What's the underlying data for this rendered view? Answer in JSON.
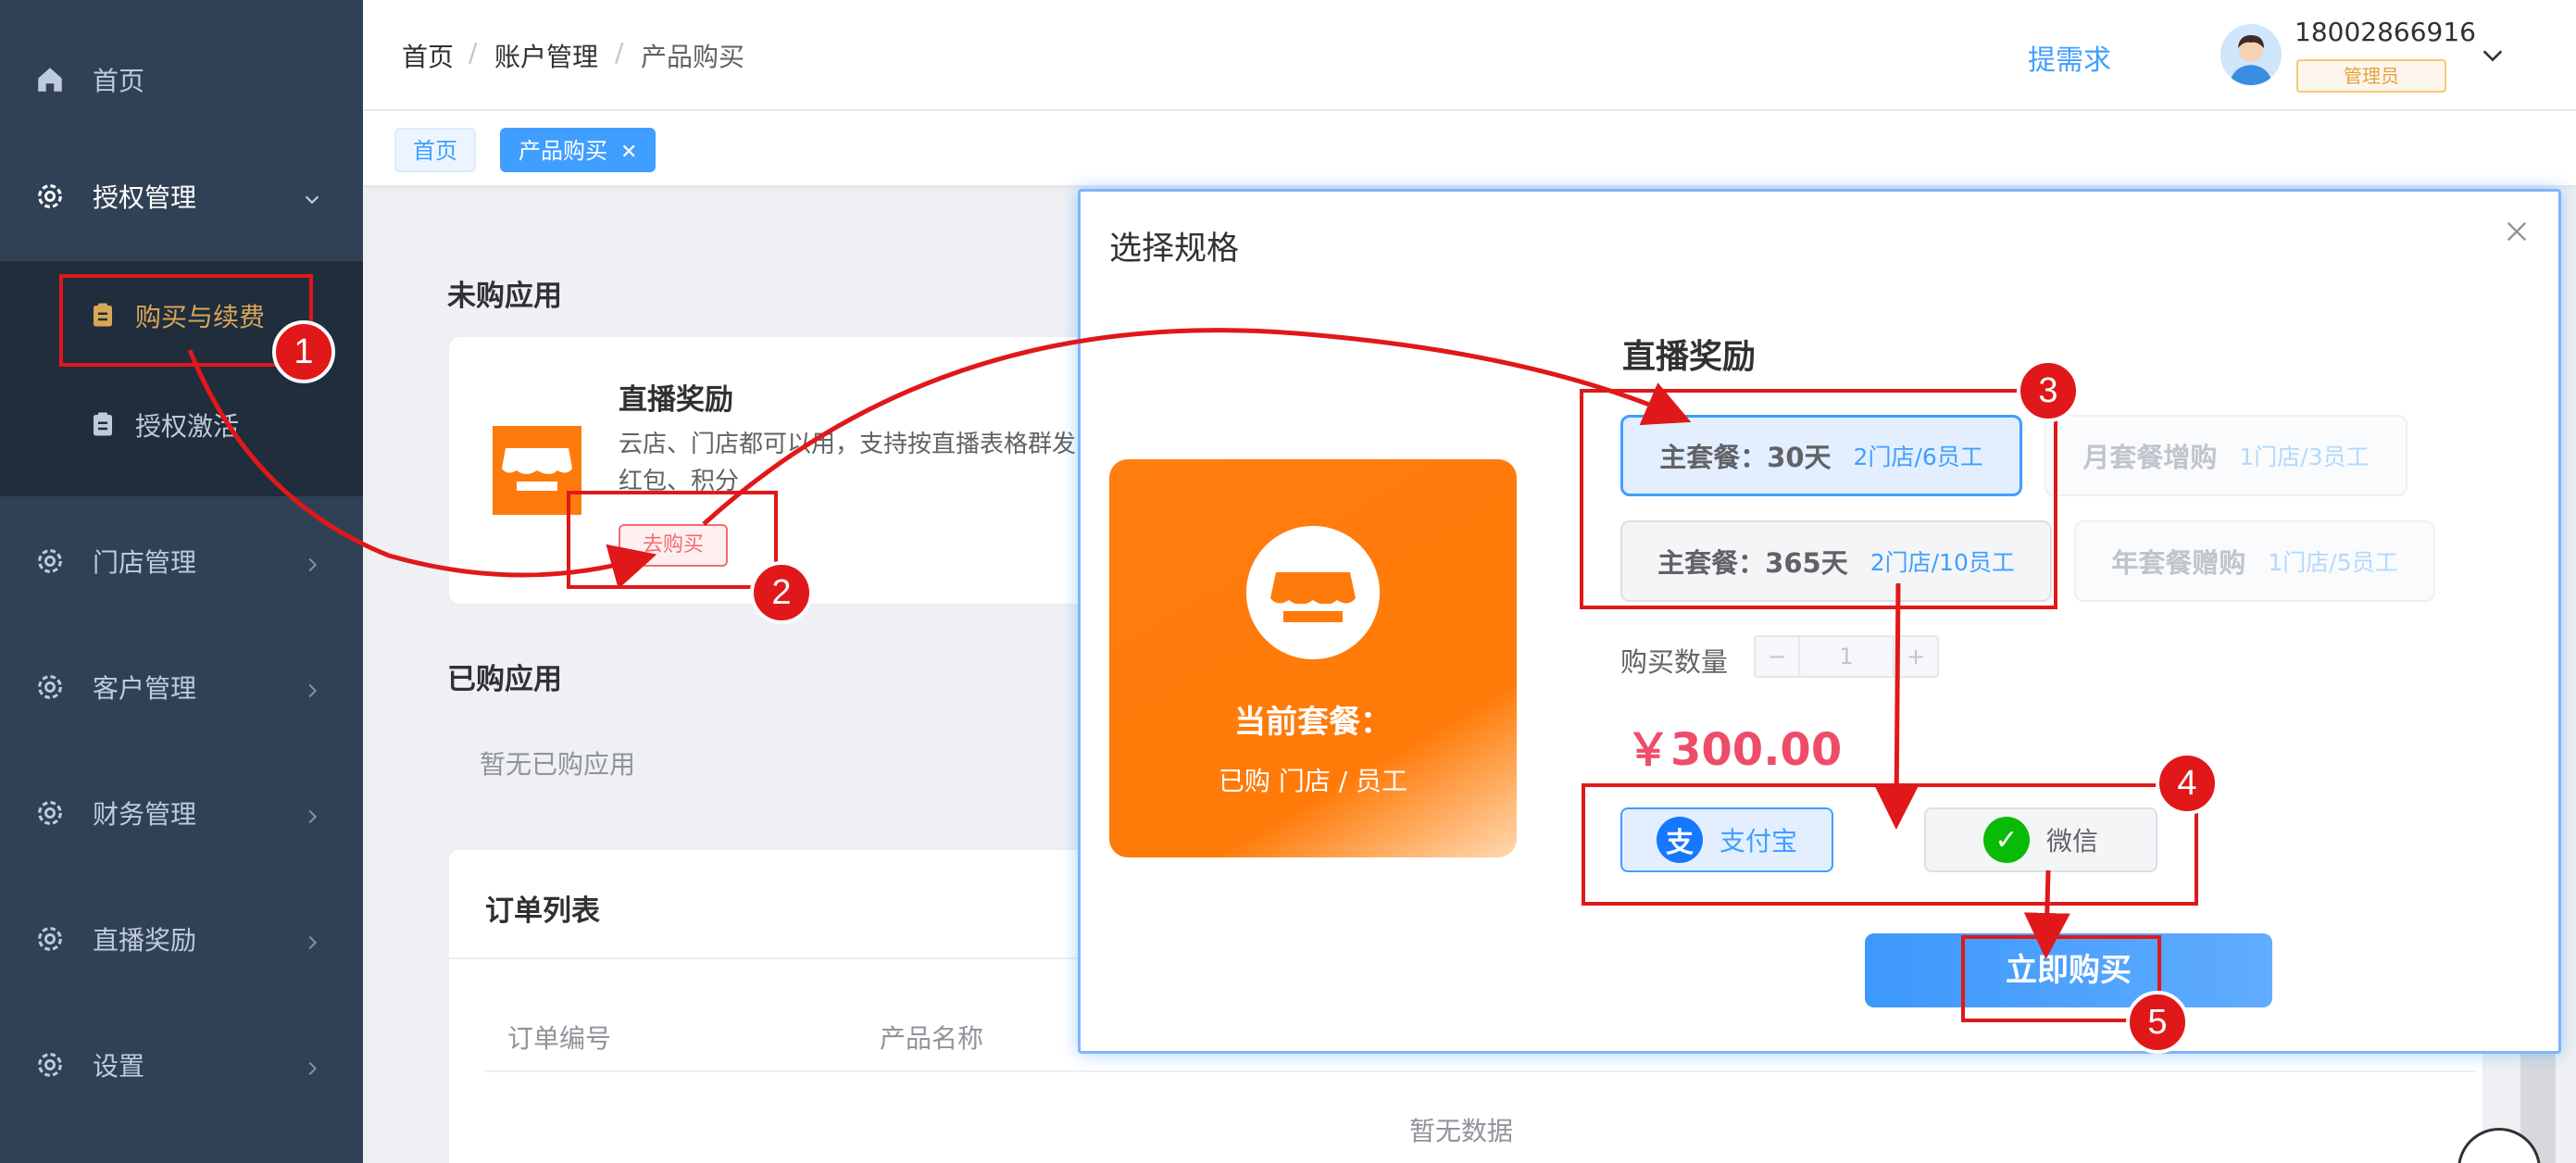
{
  "sidebar": {
    "items": [
      {
        "label": "首页",
        "icon": "home-icon"
      },
      {
        "label": "授权管理",
        "icon": "gear-icon",
        "expanded": true
      },
      {
        "label": "门店管理",
        "icon": "gear-icon"
      },
      {
        "label": "客户管理",
        "icon": "gear-icon"
      },
      {
        "label": "财务管理",
        "icon": "gear-icon"
      },
      {
        "label": "直播奖励",
        "icon": "gear-icon"
      },
      {
        "label": "设置",
        "icon": "gear-icon"
      }
    ],
    "subitems": [
      {
        "label": "购买与续费",
        "icon": "clipboard-icon",
        "active": true
      },
      {
        "label": "授权激活",
        "icon": "clipboard-icon"
      }
    ],
    "bg_color": "#304156",
    "active_color": "#d8a756"
  },
  "header": {
    "breadcrumb": [
      "首页",
      "/",
      "账户管理",
      "/",
      "产品购买"
    ],
    "need_link": "提需求",
    "user": {
      "phone": "18002866916",
      "role": "管理员"
    }
  },
  "tags": {
    "home": "首页",
    "active": "产品购买",
    "close": "✕"
  },
  "content": {
    "unpurchased_title": "未购应用",
    "app": {
      "name": "直播奖励",
      "desc": "云店、门店都可以用，支持按直播表格群发红包、积分",
      "buy_label": "去购买"
    },
    "purchased_title": "已购应用",
    "purchased_empty": "暂无已购应用",
    "orders": {
      "title": "订单列表",
      "columns": [
        "订单编号",
        "产品名称"
      ],
      "empty": "暂无数据"
    }
  },
  "dialog": {
    "title": "选择规格",
    "close": "×",
    "plan_card": {
      "label": "当前套餐：",
      "sub": "已购 门店 / 员工"
    },
    "product_name": "直播奖励",
    "specs": [
      {
        "main": "主套餐：30天",
        "note": "2门店/6员工",
        "state": "selected"
      },
      {
        "main": "月套餐增购",
        "note": "1门店/3员工",
        "state": "disabled"
      },
      {
        "main": "主套餐：365天",
        "note": "2门店/10员工",
        "state": "normal"
      },
      {
        "main": "年套餐赠购",
        "note": "1门店/5员工",
        "state": "disabled"
      }
    ],
    "quantity": {
      "label": "购买数量",
      "minus": "−",
      "value": "1",
      "plus": "+"
    },
    "price": "￥300.00",
    "payments": [
      {
        "label": "支付宝",
        "icon": "alipay-icon",
        "glyph": "支",
        "selected": true
      },
      {
        "label": "微信",
        "icon": "wechat-icon",
        "glyph": "✓",
        "selected": false
      }
    ],
    "buy_now": "立即购买"
  },
  "annotations": {
    "badges": [
      "1",
      "2",
      "3",
      "4",
      "5"
    ],
    "color": "#e0181a"
  }
}
